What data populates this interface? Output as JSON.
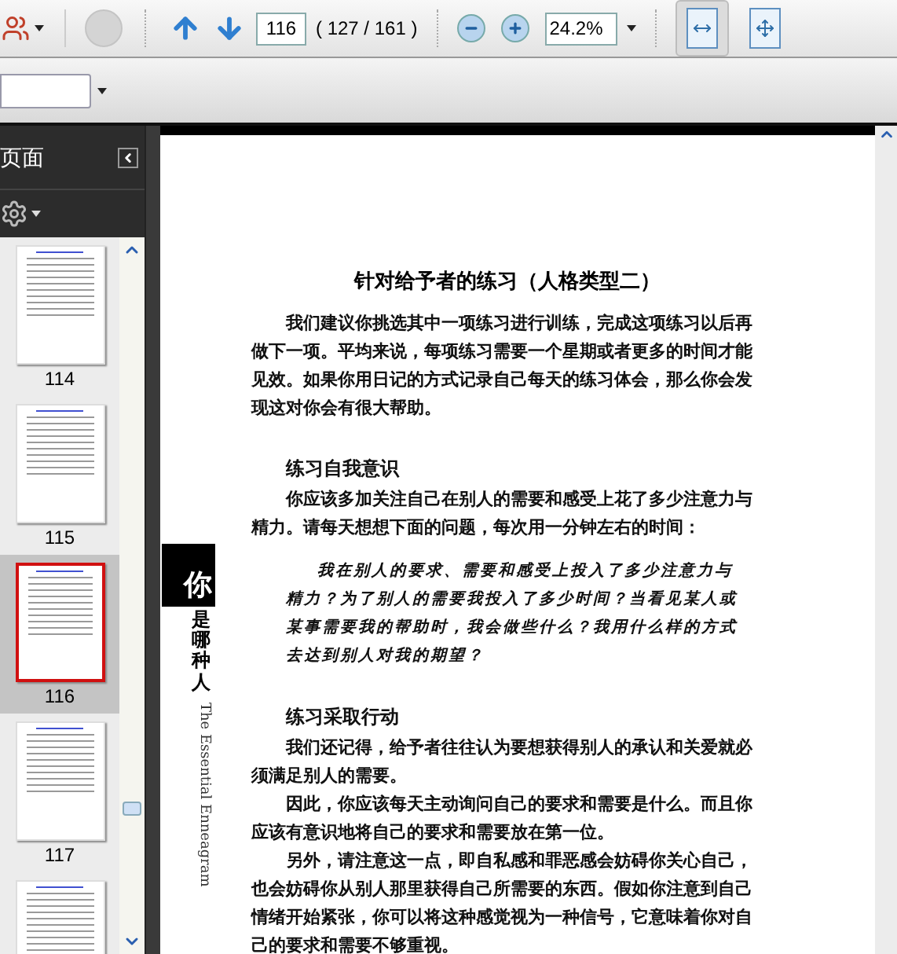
{
  "toolbar": {
    "page_number": "116",
    "page_count": "( 127 / 161 )",
    "zoom": "24.2%",
    "view_buttons": [
      {
        "kind": "fit-width",
        "selected": true
      },
      {
        "kind": "fit-page",
        "selected": false
      }
    ]
  },
  "sidebar": {
    "title": "页面",
    "thumbnails": [
      {
        "label": "114",
        "selected": false
      },
      {
        "label": "115",
        "selected": false
      },
      {
        "label": "116",
        "selected": true
      },
      {
        "label": "117",
        "selected": false
      },
      {
        "selected": false
      }
    ]
  },
  "document": {
    "side_tab": "你",
    "side_title": "是哪种人",
    "side_subtitle": "The Essential Enneagram",
    "title": "针对给予者的练习（人格类型二）",
    "blocks": [
      {
        "kind": "paragraph",
        "text": "我们建议你挑选其中一项练习进行训练，完成这项练习以后再做下一项。平均来说，每项练习需要一个星期或者更多的时间才能见效。如果你用日记的方式记录自己每天的练习体会，那么你会发现这对你会有很大帮助。"
      },
      {
        "kind": "heading",
        "text": "练习自我意识"
      },
      {
        "kind": "paragraph",
        "text": "你应该多加关注自己在别人的需要和感受上花了多少注意力与精力。请每天想想下面的问题，每次用一分钟左右的时间："
      },
      {
        "kind": "quote",
        "text": "我在别人的要求、需要和感受上投入了多少注意力与精力？为了别人的需要我投入了多少时间？当看见某人或某事需要我的帮助时，我会做些什么？我用什么样的方式去达到别人对我的期望？"
      },
      {
        "kind": "heading",
        "text": "练习采取行动"
      },
      {
        "kind": "paragraph",
        "text": "我们还记得，给予者往往认为要想获得别人的承认和关爱就必须满足别人的需要。"
      },
      {
        "kind": "paragraph",
        "text": "因此，你应该每天主动询问自己的要求和需要是什么。而且你应该有意识地将自己的要求和需要放在第一位。"
      },
      {
        "kind": "paragraph",
        "text": "另外，请注意这一点，即自私感和罪恶感会妨碍你关心自己，也会妨碍你从别人那里获得自己所需要的东西。假如你注意到自己情绪开始紧张，你可以将这种感觉视为一种信号，它意味着你对自己的要求和需要不够重视。"
      }
    ]
  }
}
